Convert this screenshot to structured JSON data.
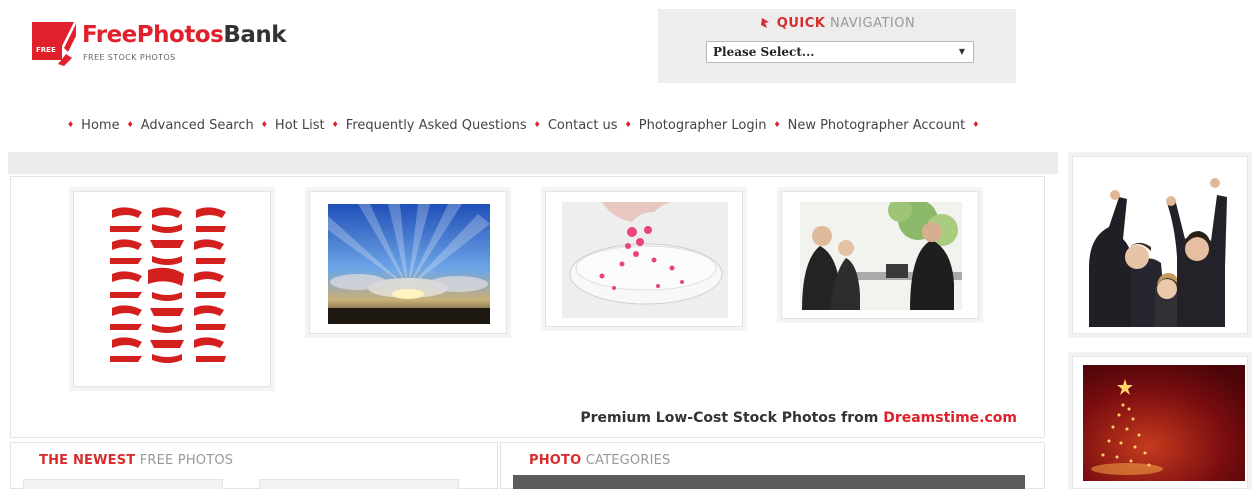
{
  "logo": {
    "name_part1": "Free",
    "name_part2": "Photos",
    "name_part3": "Bank",
    "tagline": "FREE STOCK PHOTOS",
    "mark_text": "FREE"
  },
  "quick_nav": {
    "title_bold": "QUICK",
    "title_light": "NAVIGATION",
    "select_value": "Please Select..."
  },
  "nav": {
    "items": [
      {
        "label": "Home"
      },
      {
        "label": "Advanced Search"
      },
      {
        "label": "Hot List"
      },
      {
        "label": "Frequently Asked Questions"
      },
      {
        "label": "Contact us"
      },
      {
        "label": "Photographer Login"
      },
      {
        "label": "New Photographer Account"
      }
    ]
  },
  "promo": {
    "prefix": "Premium Low-Cost Stock Photos from ",
    "brand": "Dreamstime.com"
  },
  "sections": {
    "newest_bold": "THE NEWEST",
    "newest_light": "FREE PHOTOS",
    "categories_bold": "PHOTO",
    "categories_light": "CATEGORIES"
  },
  "colors": {
    "accent_red": "#e0202a",
    "panel_gray": "#ececec"
  },
  "icons": [
    "logo-mark-icon",
    "quick-nav-arrow-icon",
    "dropdown-arrow-icon",
    "nav-bullet-icon"
  ]
}
